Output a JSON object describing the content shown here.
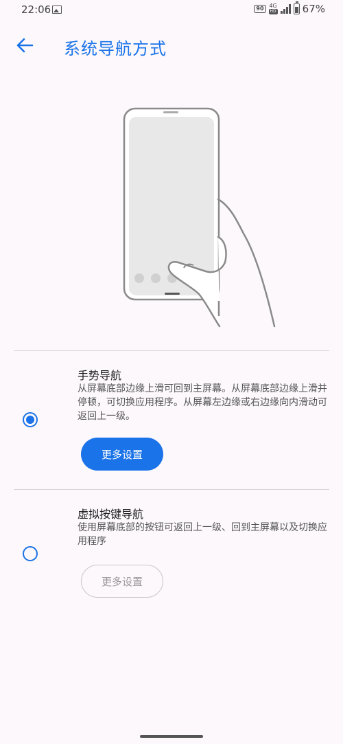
{
  "status_bar": {
    "time": "22:06",
    "refresh_badge": "90",
    "network_label": "4G",
    "network_sub": "HD",
    "battery": "67%"
  },
  "header": {
    "title": "系统导航方式"
  },
  "options": [
    {
      "title": "手势导航",
      "description": "从屏幕底部边缘上滑可回到主屏幕。从屏幕底部边缘上滑并停顿，可切换应用程序。从屏幕左边缘或右边缘向内滑动可返回上一级。",
      "button_label": "更多设置",
      "selected": true
    },
    {
      "title": "虚拟按键导航",
      "description": "使用屏幕底部的按钮可返回上一级、回到主屏幕以及切换应用程序",
      "button_label": "更多设置",
      "selected": false
    }
  ],
  "colors": {
    "accent": "#1a73e8",
    "background": "#fcf8fc"
  }
}
